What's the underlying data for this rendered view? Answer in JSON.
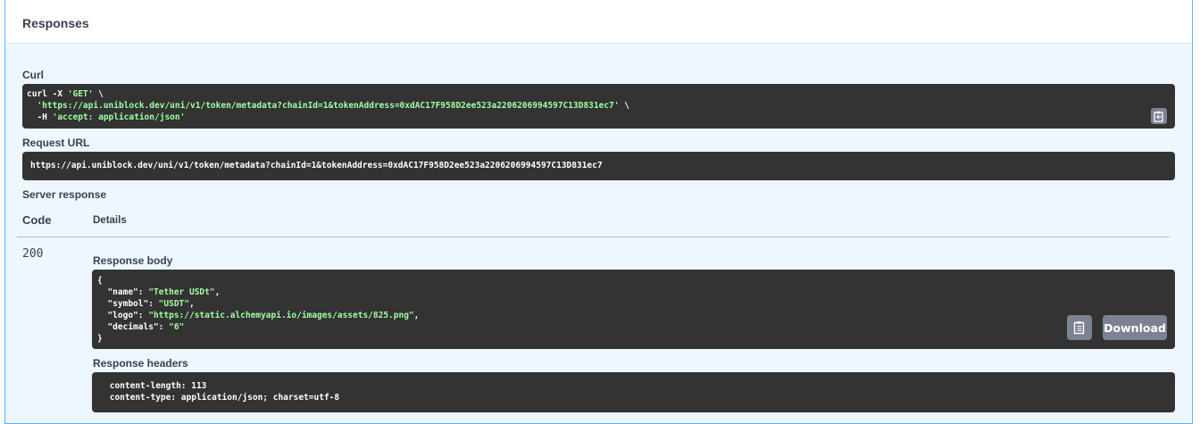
{
  "responses": {
    "title": "Responses",
    "curl_label": "Curl",
    "curl": {
      "line1_cmd": "curl -X ",
      "line1_method": "'GET'",
      "line1_tail": " \\",
      "line2_url": "'https://api.uniblock.dev/uni/v1/token/metadata?chainId=1&tokenAddress=0xdAC17F958D2ee523a2206206994597C13D831ec7'",
      "line2_tail": " \\",
      "line3_flag": "  -H ",
      "line3_header": "'accept: application/json'"
    },
    "request_url_label": "Request URL",
    "request_url": "https://api.uniblock.dev/uni/v1/token/metadata?chainId=1&tokenAddress=0xdAC17F958D2ee523a2206206994597C13D831ec7",
    "server_response_label": "Server response",
    "code_header": "Code",
    "details_header": "Details",
    "status_code": "200",
    "response_body_label": "Response body",
    "body": {
      "open": "{",
      "name_key": "\"name\"",
      "name_val": "\"Tether USDt\"",
      "symbol_key": "\"symbol\"",
      "symbol_val": "\"USDT\"",
      "logo_key": "\"logo\"",
      "logo_val": "\"https://static.alchemyapi.io/images/assets/825.png\"",
      "decimals_key": "\"decimals\"",
      "decimals_val": "\"6\"",
      "close": "}"
    },
    "download_label": "Download",
    "response_headers_label": "Response headers",
    "headers": [
      " content-length: 113",
      " content-type: application/json; charset=utf-8"
    ]
  }
}
